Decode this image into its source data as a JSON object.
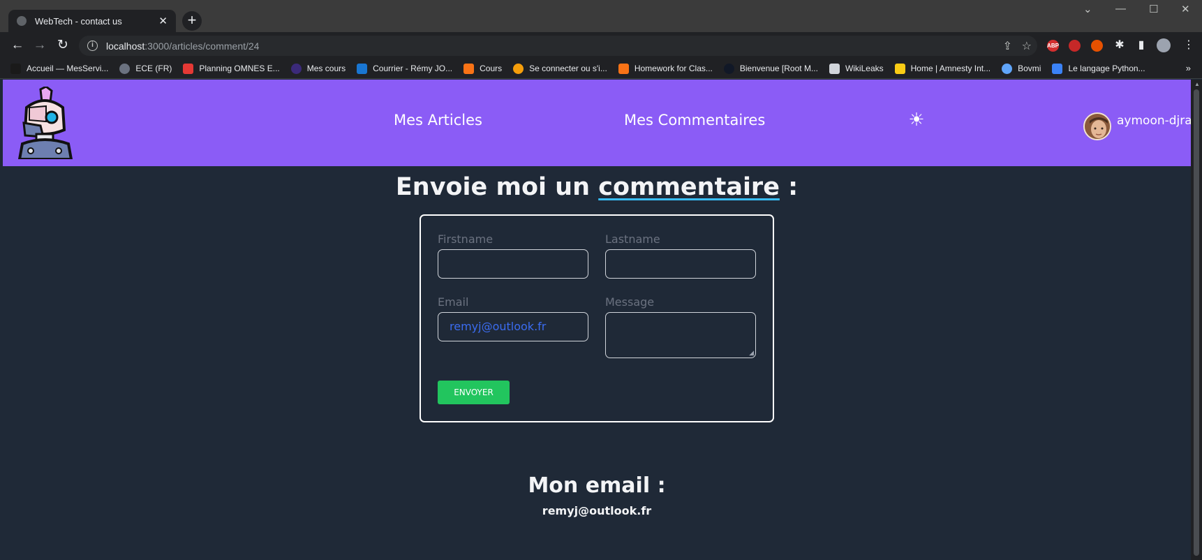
{
  "browser": {
    "tab_title": "WebTech - contact us",
    "new_tab": "+",
    "url_host": "localhost",
    "url_rest": ":3000/articles/comment/24",
    "bookmarks": [
      {
        "label": "Accueil — MesServi...",
        "color": "#1a1a1a"
      },
      {
        "label": "ECE (FR)",
        "color": "#6b7280"
      },
      {
        "label": "Planning OMNES E...",
        "color": "#e53935"
      },
      {
        "label": "Mes cours",
        "color": "#3b2a7a"
      },
      {
        "label": "Courrier - Rémy JO...",
        "color": "#1976d2"
      },
      {
        "label": "Cours",
        "color": "#f97316"
      },
      {
        "label": "Se connecter ou s'i...",
        "color": "#f59e0b"
      },
      {
        "label": "Homework for Clas...",
        "color": "#f97316"
      },
      {
        "label": "Bienvenue [Root M...",
        "color": "#111827"
      },
      {
        "label": "WikiLeaks",
        "color": "#d1d5db"
      },
      {
        "label": "Home | Amnesty Int...",
        "color": "#facc15"
      },
      {
        "label": "Bovmi",
        "color": "#60a5fa"
      },
      {
        "label": "Le langage Python...",
        "color": "#3b82f6"
      }
    ],
    "bookmarks_more": "»",
    "extensions": [
      {
        "name": "adblock-icon",
        "label": "ABP",
        "color": "#d32f2f"
      },
      {
        "name": "shield-ext-icon",
        "label": "",
        "color": "#c62828"
      },
      {
        "name": "download-ext-icon",
        "label": "",
        "color": "#e65100"
      }
    ]
  },
  "header": {
    "nav_articles": "Mes Articles",
    "nav_comments": "Mes Commentaires",
    "theme_icon": "☀",
    "username": "aymoon-djrak"
  },
  "main": {
    "heading_prefix": "Envoie moi un ",
    "heading_emphasis": "commentaire",
    "heading_suffix": " :",
    "form": {
      "firstname_label": "Firstname",
      "firstname_value": "",
      "lastname_label": "Lastname",
      "lastname_value": "",
      "email_label": "Email",
      "email_value": "remyj@outlook.fr",
      "message_label": "Message",
      "message_value": "",
      "send_label": "ENVOYER"
    },
    "email_title": "Mon email :",
    "email_value": "remyj@outlook.fr"
  }
}
